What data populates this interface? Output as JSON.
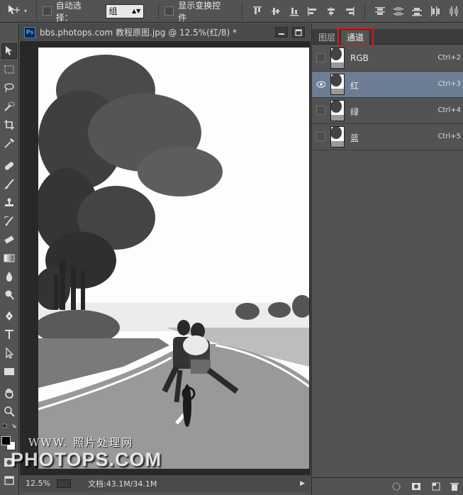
{
  "options_bar": {
    "auto_select_label": "自动选择：",
    "auto_select_value": "组",
    "show_transform_label": "显示变换控件"
  },
  "document": {
    "ps_badge": "Ps",
    "title": "bbs.photops.com 教程原图.jpg @ 12.5%(红/8) *",
    "zoom": "12.5%",
    "doc_info": "文档:43.1M/34.1M"
  },
  "panel": {
    "tabs": [
      {
        "label": "图层"
      },
      {
        "label": "通道"
      }
    ],
    "channels": [
      {
        "name": "RGB",
        "shortcut": "Ctrl+2",
        "visible": false,
        "selected": false
      },
      {
        "name": "红",
        "shortcut": "Ctrl+3",
        "visible": true,
        "selected": true
      },
      {
        "name": "绿",
        "shortcut": "Ctrl+4",
        "visible": false,
        "selected": false
      },
      {
        "name": "蓝",
        "shortcut": "Ctrl+5",
        "visible": false,
        "selected": false
      }
    ]
  },
  "watermark": {
    "line1": "WWW. 照片处理网",
    "line2": "PHOTOPS.COM"
  },
  "colors": {
    "selected_row": "#6c7d94",
    "highlight_box": "#d11d1d",
    "ui_background": "#535353"
  }
}
